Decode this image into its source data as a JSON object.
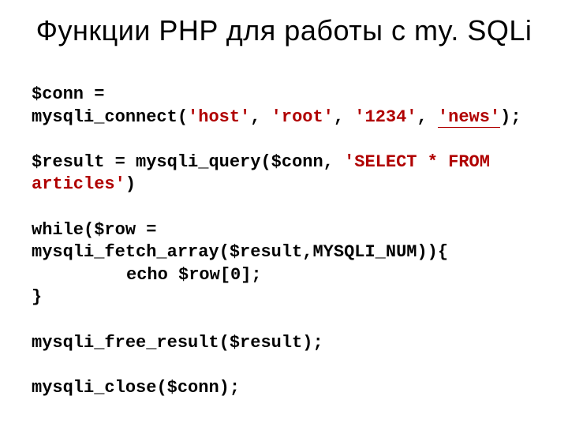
{
  "title": "Функции PHP для работы с my. SQLi",
  "code": {
    "l1a": "$conn = ",
    "l2a": "mysqli_connect",
    "l2b": "(",
    "l2c": "'host'",
    "l2d": ", ",
    "l2e": "'root'",
    "l2f": ", ",
    "l2g": "'1234'",
    "l2h": ", ",
    "l2i": "'news'",
    "l2j": ");",
    "l3a": "$result = ",
    "l3b": "mysqli_query",
    "l3c": "($conn, ",
    "l3d": "'SELECT * FROM",
    "l4a": "articles'",
    "l4b": ")",
    "l5a": "while",
    "l5b": "($row = ",
    "l6a": "mysqli_fetch_array",
    "l6b": "($result,MYSQLI_NUM)){",
    "l7a": "echo ",
    "l7b": "$row[0];",
    "l8a": "}",
    "l9a": "mysqli_free_result",
    "l9b": "($result);",
    "l10a": "mysqli_close",
    "l10b": "($conn);"
  }
}
